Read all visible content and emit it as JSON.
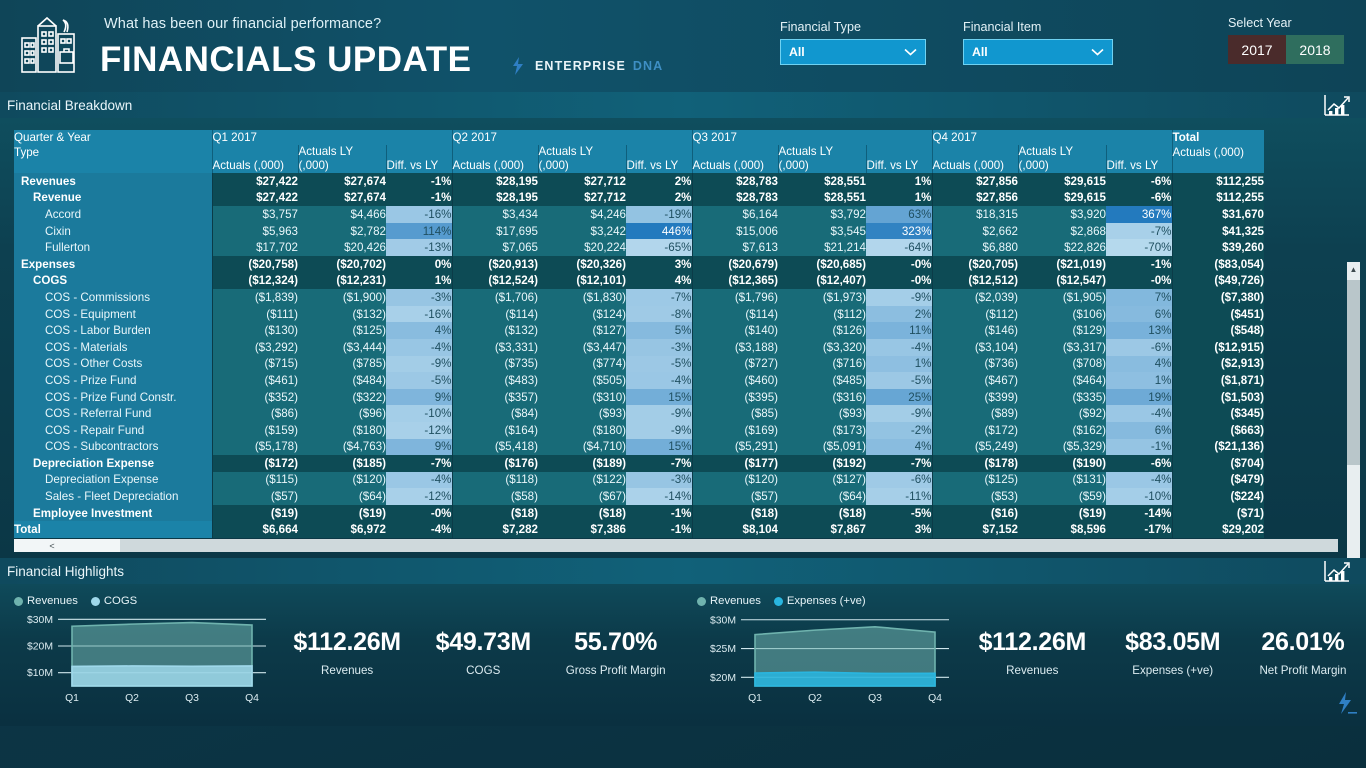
{
  "header": {
    "question": "What has been our financial performance?",
    "title": "FINANCIALS UPDATE",
    "brand_primary": "ENTERPRISE",
    "brand_secondary": "DNA",
    "logo_icon": "building-icon",
    "brand_icon": "enterprise-dna-logo-icon"
  },
  "filters": {
    "financial_type": {
      "label": "Financial Type",
      "value": "All",
      "icon": "chevron-down-icon"
    },
    "financial_item": {
      "label": "Financial Item",
      "value": "All",
      "icon": "chevron-down-icon"
    },
    "year": {
      "label": "Select Year",
      "options": [
        "2017",
        "2018"
      ],
      "selected": "2017"
    }
  },
  "sections": {
    "breakdown_title": "Financial Breakdown",
    "highlights_title": "Financial Highlights",
    "section_icon": "bar-chart-growth-icon"
  },
  "matrix": {
    "row_header_top": "Quarter & Year",
    "row_header_bottom": "Type",
    "quarters": [
      "Q1 2017",
      "Q2 2017",
      "Q3 2017",
      "Q4 2017"
    ],
    "total_header_top": "Total",
    "sub_headers": [
      "Actuals (,000)",
      "Actuals LY (,000)",
      "Diff. vs LY"
    ],
    "total_sub_header": "Actuals (,000)",
    "rows": [
      {
        "label": "Revenues",
        "level": 0,
        "style": "head",
        "cells": [
          "$27,422",
          "$27,674",
          "-1%",
          "$28,195",
          "$27,712",
          "2%",
          "$28,783",
          "$28,551",
          "1%",
          "$27,856",
          "$29,615",
          "-6%"
        ],
        "total": "$112,255"
      },
      {
        "label": "Revenue",
        "level": 1,
        "style": "head",
        "cells": [
          "$27,422",
          "$27,674",
          "-1%",
          "$28,195",
          "$27,712",
          "2%",
          "$28,783",
          "$28,551",
          "1%",
          "$27,856",
          "$29,615",
          "-6%"
        ],
        "total": "$112,255"
      },
      {
        "label": "Accord",
        "level": 2,
        "style": "detail",
        "cells": [
          "$3,757",
          "$4,466",
          "-16%",
          "$3,434",
          "$4,246",
          "-19%",
          "$6,164",
          "$3,792",
          "63%",
          "$18,315",
          "$3,920",
          "367%"
        ],
        "total": "$31,670",
        "diff_shade": [
          0.3,
          0.34,
          0.62,
          1.0
        ]
      },
      {
        "label": "Cixin",
        "level": 2,
        "style": "detail",
        "cells": [
          "$5,963",
          "$2,782",
          "114%",
          "$17,695",
          "$3,242",
          "446%",
          "$15,006",
          "$3,545",
          "323%",
          "$2,662",
          "$2,868",
          "-7%"
        ],
        "total": "$41,325",
        "diff_shade": [
          0.7,
          1.0,
          0.92,
          0.22
        ]
      },
      {
        "label": "Fullerton",
        "level": 2,
        "style": "detail",
        "cells": [
          "$17,702",
          "$20,426",
          "-13%",
          "$7,065",
          "$20,224",
          "-65%",
          "$7,613",
          "$21,214",
          "-64%",
          "$6,880",
          "$22,826",
          "-70%"
        ],
        "total": "$39,260",
        "diff_shade": [
          0.26,
          0.16,
          0.16,
          0.14
        ]
      },
      {
        "label": "Expenses",
        "level": 0,
        "style": "head",
        "cells": [
          "($20,758)",
          "($20,702)",
          "0%",
          "($20,913)",
          "($20,326)",
          "3%",
          "($20,679)",
          "($20,685)",
          "-0%",
          "($20,705)",
          "($21,019)",
          "-1%"
        ],
        "total": "($83,054)"
      },
      {
        "label": "COGS",
        "level": 1,
        "style": "head",
        "cells": [
          "($12,324)",
          "($12,231)",
          "1%",
          "($12,524)",
          "($12,101)",
          "4%",
          "($12,365)",
          "($12,407)",
          "-0%",
          "($12,512)",
          "($12,547)",
          "-0%"
        ],
        "total": "($49,726)"
      },
      {
        "label": "COS - Commissions",
        "level": 2,
        "style": "detail",
        "cells": [
          "($1,839)",
          "($1,900)",
          "-3%",
          "($1,706)",
          "($1,830)",
          "-7%",
          "($1,796)",
          "($1,973)",
          "-9%",
          "($2,039)",
          "($1,905)",
          "7%"
        ],
        "total": "($7,380)",
        "diff_shade": [
          0.32,
          0.28,
          0.24,
          0.44
        ]
      },
      {
        "label": "COS - Equipment",
        "level": 2,
        "style": "detail",
        "cells": [
          "($111)",
          "($132)",
          "-16%",
          "($114)",
          "($124)",
          "-8%",
          "($114)",
          "($112)",
          "2%",
          "($112)",
          "($106)",
          "6%"
        ],
        "total": "($451)",
        "diff_shade": [
          0.22,
          0.27,
          0.38,
          0.42
        ]
      },
      {
        "label": "COS - Labor Burden",
        "level": 2,
        "style": "detail",
        "cells": [
          "($130)",
          "($125)",
          "4%",
          "($132)",
          "($127)",
          "5%",
          "($140)",
          "($126)",
          "11%",
          "($146)",
          "($129)",
          "13%"
        ],
        "total": "($548)",
        "diff_shade": [
          0.4,
          0.42,
          0.48,
          0.5
        ]
      },
      {
        "label": "COS - Materials",
        "level": 2,
        "style": "detail",
        "cells": [
          "($3,292)",
          "($3,444)",
          "-4%",
          "($3,331)",
          "($3,447)",
          "-3%",
          "($3,188)",
          "($3,320)",
          "-4%",
          "($3,104)",
          "($3,317)",
          "-6%"
        ],
        "total": "($12,915)",
        "diff_shade": [
          0.31,
          0.32,
          0.31,
          0.29
        ]
      },
      {
        "label": "COS - Other Costs",
        "level": 2,
        "style": "detail",
        "cells": [
          "($715)",
          "($785)",
          "-9%",
          "($735)",
          "($774)",
          "-5%",
          "($727)",
          "($716)",
          "1%",
          "($736)",
          "($708)",
          "4%"
        ],
        "total": "($2,913)",
        "diff_shade": [
          0.25,
          0.29,
          0.37,
          0.4
        ]
      },
      {
        "label": "COS - Prize Fund",
        "level": 2,
        "style": "detail",
        "cells": [
          "($461)",
          "($484)",
          "-5%",
          "($483)",
          "($505)",
          "-4%",
          "($460)",
          "($485)",
          "-5%",
          "($467)",
          "($464)",
          "1%"
        ],
        "total": "($1,871)",
        "diff_shade": [
          0.29,
          0.3,
          0.29,
          0.37
        ]
      },
      {
        "label": "COS - Prize Fund Constr.",
        "level": 2,
        "style": "detail",
        "cells": [
          "($352)",
          "($322)",
          "9%",
          "($357)",
          "($310)",
          "15%",
          "($395)",
          "($316)",
          "25%",
          "($399)",
          "($335)",
          "19%"
        ],
        "total": "($1,503)",
        "diff_shade": [
          0.46,
          0.53,
          0.6,
          0.56
        ]
      },
      {
        "label": "COS - Referral Fund",
        "level": 2,
        "style": "detail",
        "cells": [
          "($86)",
          "($96)",
          "-10%",
          "($84)",
          "($93)",
          "-9%",
          "($85)",
          "($93)",
          "-9%",
          "($89)",
          "($92)",
          "-4%"
        ],
        "total": "($345)",
        "diff_shade": [
          0.24,
          0.25,
          0.25,
          0.3
        ]
      },
      {
        "label": "COS - Repair Fund",
        "level": 2,
        "style": "detail",
        "cells": [
          "($159)",
          "($180)",
          "-12%",
          "($164)",
          "($180)",
          "-9%",
          "($169)",
          "($173)",
          "-2%",
          "($172)",
          "($162)",
          "6%"
        ],
        "total": "($663)",
        "diff_shade": [
          0.22,
          0.25,
          0.34,
          0.42
        ]
      },
      {
        "label": "COS - Subcontractors",
        "level": 2,
        "style": "detail",
        "cells": [
          "($5,178)",
          "($4,763)",
          "9%",
          "($5,418)",
          "($4,710)",
          "15%",
          "($5,291)",
          "($5,091)",
          "4%",
          "($5,249)",
          "($5,329)",
          "-1%"
        ],
        "total": "($21,136)",
        "diff_shade": [
          0.46,
          0.53,
          0.4,
          0.33
        ]
      },
      {
        "label": "Depreciation Expense",
        "level": 1,
        "style": "head",
        "cells": [
          "($172)",
          "($185)",
          "-7%",
          "($176)",
          "($189)",
          "-7%",
          "($177)",
          "($192)",
          "-7%",
          "($178)",
          "($190)",
          "-6%"
        ],
        "total": "($704)"
      },
      {
        "label": "Depreciation Expense",
        "level": 2,
        "style": "detail",
        "cells": [
          "($115)",
          "($120)",
          "-4%",
          "($118)",
          "($122)",
          "-3%",
          "($120)",
          "($127)",
          "-6%",
          "($125)",
          "($131)",
          "-4%"
        ],
        "total": "($479)",
        "diff_shade": [
          0.3,
          0.32,
          0.27,
          0.3
        ]
      },
      {
        "label": "Sales - Fleet Depreciation",
        "level": 2,
        "style": "detail",
        "cells": [
          "($57)",
          "($64)",
          "-12%",
          "($58)",
          "($67)",
          "-14%",
          "($57)",
          "($64)",
          "-11%",
          "($53)",
          "($59)",
          "-10%"
        ],
        "total": "($224)",
        "diff_shade": [
          0.22,
          0.2,
          0.23,
          0.24
        ]
      },
      {
        "label": "Employee Investment",
        "level": 1,
        "style": "head",
        "cells": [
          "($19)",
          "($19)",
          "-0%",
          "($18)",
          "($18)",
          "-1%",
          "($18)",
          "($18)",
          "-5%",
          "($16)",
          "($19)",
          "-14%"
        ],
        "total": "($71)"
      }
    ],
    "total_row": {
      "label": "Total",
      "cells": [
        "$6,664",
        "$6,972",
        "-4%",
        "$7,282",
        "$7,386",
        "-1%",
        "$8,104",
        "$7,867",
        "3%",
        "$7,152",
        "$8,596",
        "-17%"
      ],
      "total": "$29,202"
    }
  },
  "chart_data": [
    {
      "type": "area",
      "title": "Financial Highlights - Revenues vs COGS",
      "categories": [
        "Q1",
        "Q2",
        "Q3",
        "Q4"
      ],
      "x": [
        "Q1",
        "Q2",
        "Q3",
        "Q4"
      ],
      "series": [
        {
          "name": "Revenues",
          "values": [
            27.42,
            28.2,
            28.78,
            27.86
          ],
          "color": "#6fb3ae"
        },
        {
          "name": "COGS",
          "values": [
            12.32,
            12.52,
            12.37,
            12.51
          ],
          "color": "#9fd8ea"
        }
      ],
      "ylabel": "",
      "xlabel": "",
      "ylim": [
        5,
        32
      ],
      "yticks": [
        10,
        20,
        30
      ],
      "ytick_labels": [
        "$10M",
        "$20M",
        "$30M"
      ],
      "grid": true,
      "legend": "top-left"
    },
    {
      "type": "area",
      "title": "Financial Highlights - Revenues vs Expenses",
      "categories": [
        "Q1",
        "Q2",
        "Q3",
        "Q4"
      ],
      "x": [
        "Q1",
        "Q2",
        "Q3",
        "Q4"
      ],
      "series": [
        {
          "name": "Revenues",
          "values": [
            27.42,
            28.2,
            28.78,
            27.86
          ],
          "color": "#6fb3ae"
        },
        {
          "name": "Expenses (+ve)",
          "values": [
            20.76,
            20.91,
            20.68,
            20.71
          ],
          "color": "#29b6e0"
        }
      ],
      "ylabel": "",
      "xlabel": "",
      "ylim": [
        18.5,
        31
      ],
      "yticks": [
        20,
        25,
        30
      ],
      "ytick_labels": [
        "$20M",
        "$25M",
        "$30M"
      ],
      "grid": true,
      "legend": "top-left"
    }
  ],
  "kpis_left": [
    {
      "value": "$112.26M",
      "label": "Revenues"
    },
    {
      "value": "$49.73M",
      "label": "COGS"
    },
    {
      "value": "55.70%",
      "label": "Gross Profit Margin"
    }
  ],
  "kpis_right": [
    {
      "value": "$112.26M",
      "label": "Revenues"
    },
    {
      "value": "$83.05M",
      "label": "Expenses (+ve)"
    },
    {
      "value": "26.01%",
      "label": "Net Profit Margin"
    }
  ],
  "colors": {
    "accent": "#1b83a8",
    "header_bg": "#10526a",
    "detail_row": "#186b78",
    "group_row": "#0d4b55",
    "diff_shade": "#a8dff0",
    "year_selected": "#4a2b2b",
    "year_unselected": "#2f6e5e"
  }
}
